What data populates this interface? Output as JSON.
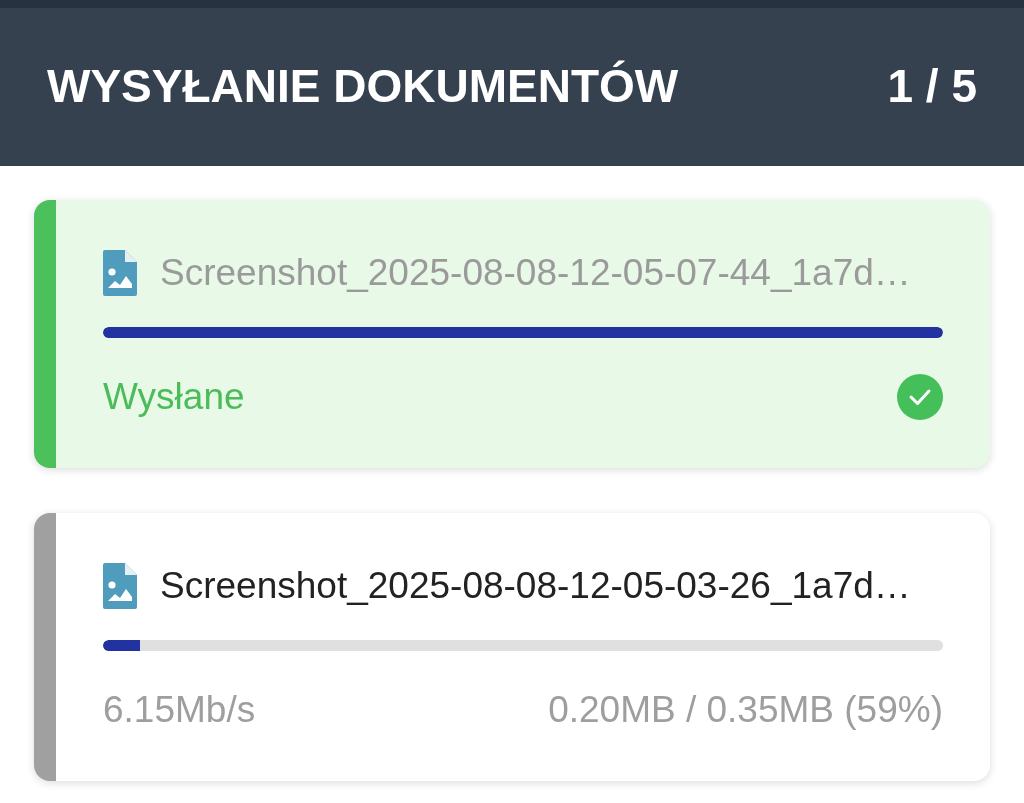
{
  "header": {
    "title": "WYSYŁANIE DOKUMENTÓW",
    "counter": "1 / 5"
  },
  "uploads": [
    {
      "kind": "done",
      "filename": "Screenshot_2025-08-08-12-05-07-44_1a7d…",
      "level": 1,
      "status": "Wysłane"
    },
    {
      "kind": "uploading",
      "filename": "Screenshot_2025-08-08-12-05-03-26_1a7d…",
      "level": 0.044,
      "speed": "6.15Mb/s",
      "size": "0.20MB / 0.35MB (59%)"
    }
  ]
}
